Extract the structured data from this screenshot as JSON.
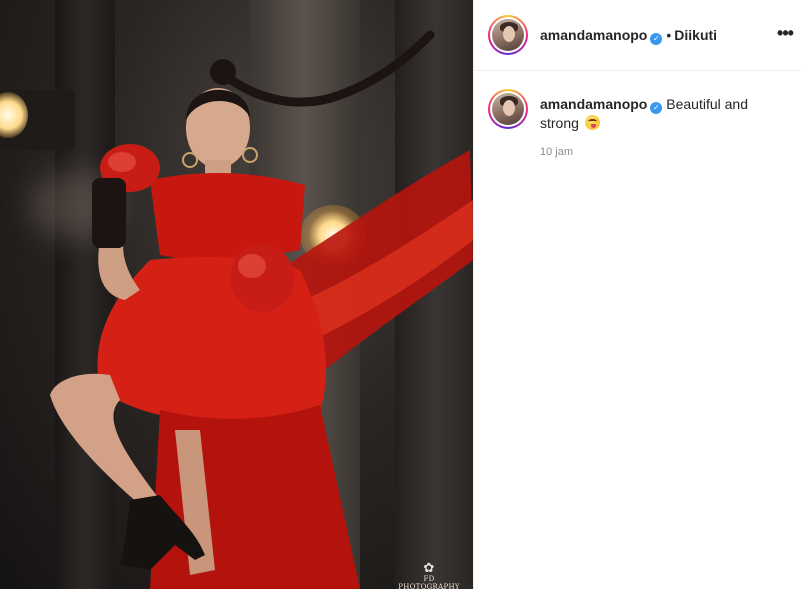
{
  "post": {
    "username": "amandamanopo",
    "verified_icon": "verified-badge-icon",
    "separator": "•",
    "follow_status": "Diikuti",
    "more_icon": "more-options-icon",
    "caption_text": "Beautiful and strong",
    "caption_emoji": "face-savoring-food-emoji",
    "timestamp": "10 jam"
  },
  "photo": {
    "watermark": "FD PHOTOGRAPHY"
  },
  "colors": {
    "verified_blue": "#3897f0",
    "dress_red": "#c8170f",
    "meta_gray": "#8e8e8e"
  }
}
